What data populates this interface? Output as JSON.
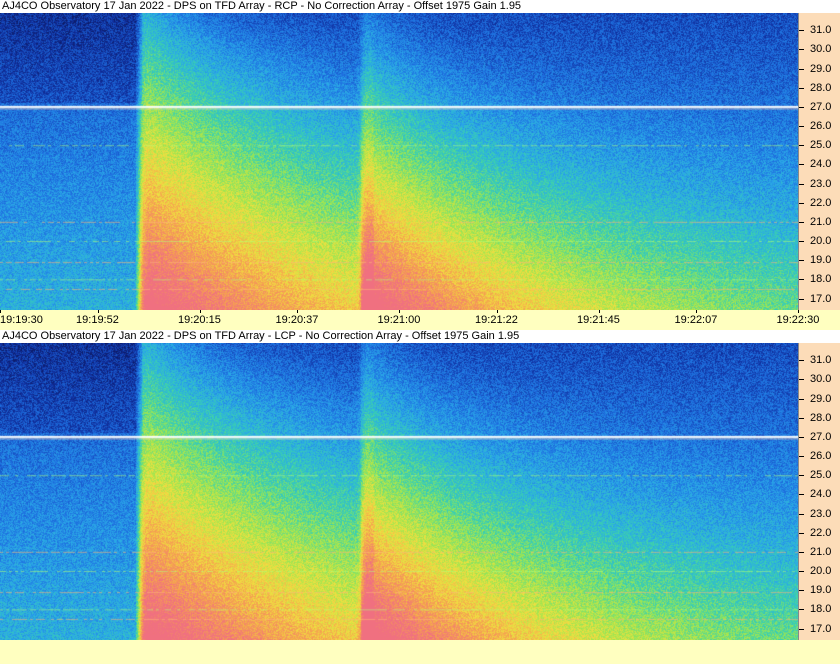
{
  "window": {
    "rcp_title": "AJ4CO Observatory 17 Jan 2022 - DPS on TFD Array  - RCP  -  No Correction Array  -  Offset 1975  Gain 1.95",
    "lcp_title": "AJ4CO Observatory 17 Jan 2022 - DPS on TFD Array  - LCP  -  No Correction Array  -  Offset 1975  Gain 1.95"
  },
  "colors": {
    "title_bg": "#ffffff",
    "axis_bg_y": "#fcdcb8",
    "axis_bg_x": "#ffffc0",
    "colormap": [
      "#0a0a3a",
      "#1030a0",
      "#1e6fe0",
      "#2aa8e8",
      "#3ad0b0",
      "#9ee650",
      "#f0e040",
      "#f5a050",
      "#f07080"
    ]
  },
  "chart_data": [
    {
      "type": "heatmap",
      "title": "AJ4CO Observatory 17 Jan 2022 - DPS on TFD Array  - RCP  -  No Correction Array  -  Offset 1975  Gain 1.95",
      "polarization": "RCP",
      "y_axis_label": "",
      "x_axis_label": "",
      "y_ticks": [
        "31.0",
        "30.0",
        "29.0",
        "28.0",
        "27.0",
        "26.0",
        "25.0",
        "24.0",
        "23.0",
        "22.0",
        "21.0",
        "20.0",
        "19.0",
        "18.0",
        "17.0"
      ],
      "y_range": [
        16.4,
        31.9
      ],
      "x_ticks": [
        "19:19:30",
        "19:19:52",
        "19:20:15",
        "19:20:37",
        "19:21:00",
        "19:21:22",
        "19:21:45",
        "19:22:07",
        "19:22:30"
      ],
      "x_range": [
        "19:19:30",
        "19:22:30"
      ],
      "features": {
        "main_burst_start": "19:20:02",
        "second_burst_start": "19:20:52",
        "strong_rfi_line": 27.0,
        "rfi_lines": [
          25.0,
          21.0,
          20.0,
          18.9,
          18.0,
          17.5
        ]
      }
    },
    {
      "type": "heatmap",
      "title": "AJ4CO Observatory 17 Jan 2022 - DPS on TFD Array  - LCP  -  No Correction Array  -  Offset 1975  Gain 1.95",
      "polarization": "LCP",
      "y_axis_label": "",
      "x_axis_label": "",
      "y_ticks": [
        "31.0",
        "30.0",
        "29.0",
        "28.0",
        "27.0",
        "26.0",
        "25.0",
        "24.0",
        "23.0",
        "22.0",
        "21.0",
        "20.0",
        "19.0",
        "18.0",
        "17.0"
      ],
      "y_range": [
        16.4,
        31.9
      ],
      "x_ticks": [],
      "x_range": [
        "19:19:30",
        "19:22:30"
      ],
      "features": {
        "main_burst_start": "19:20:02",
        "second_burst_start": "19:20:52",
        "strong_rfi_line": 27.0,
        "rfi_lines": [
          25.0,
          21.0,
          20.0,
          18.9,
          18.0,
          17.5
        ]
      }
    }
  ]
}
